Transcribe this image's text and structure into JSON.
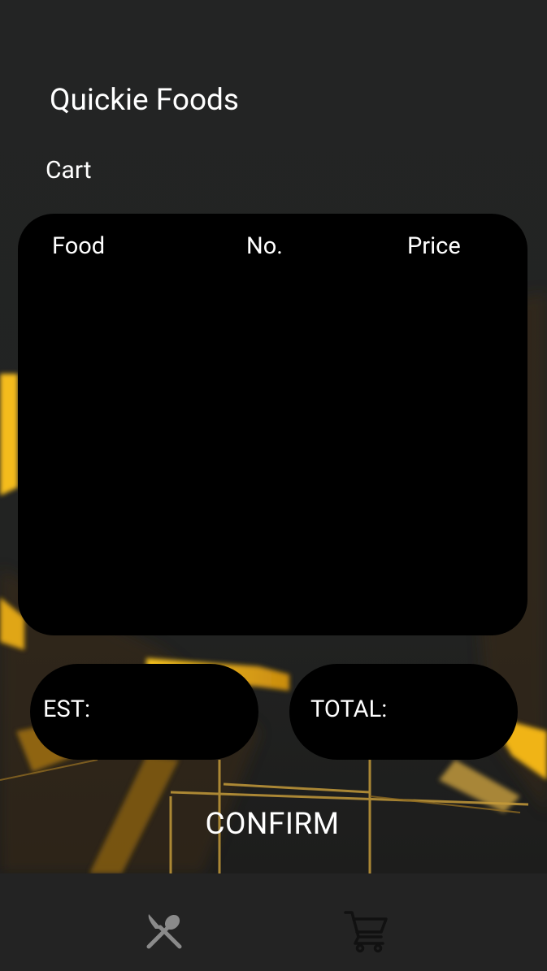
{
  "app": {
    "title": "Quickie Foods"
  },
  "cart": {
    "title": "Cart",
    "columns": [
      "Food",
      "No.",
      "Price"
    ],
    "items": []
  },
  "summary": {
    "est_label": "EST:",
    "total_label": "TOTAL:"
  },
  "actions": {
    "confirm_label": "CONFIRM"
  },
  "bottom_nav": [
    {
      "icon": "fork-knife-icon",
      "selected": false
    },
    {
      "icon": "shopping-cart-icon",
      "selected": true
    }
  ],
  "colors": {
    "background": "#222322",
    "card": "#000000",
    "accent_glow": "#f2b418",
    "text": "#ffffff",
    "nav_inactive": "#8a8a8a",
    "nav_active": "#111111"
  }
}
